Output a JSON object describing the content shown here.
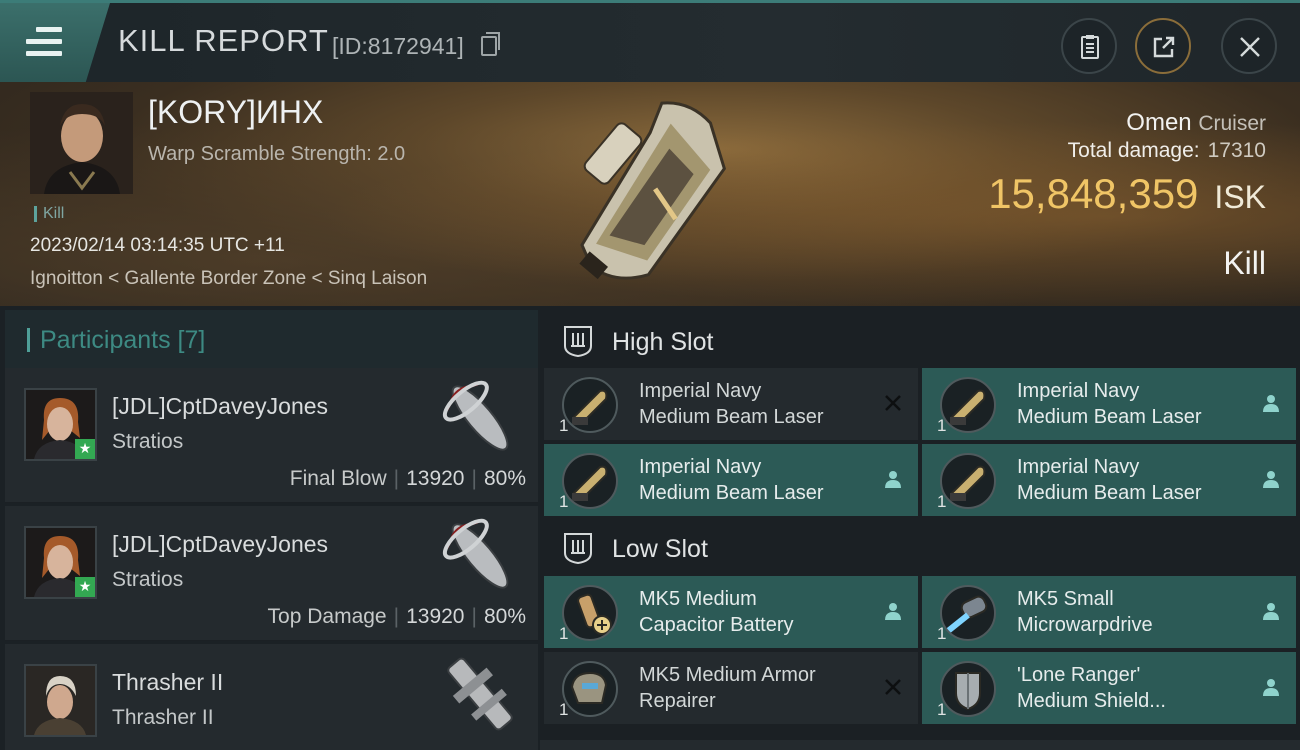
{
  "header": {
    "title": "KILL REPORT",
    "report_id": "[ID:8172941]",
    "icons": {
      "menu": "hamburger-menu-icon",
      "copy": "copy-icon",
      "clipboard": "clipboard-icon",
      "share": "share-icon",
      "close": "close-icon"
    }
  },
  "victim": {
    "name": "[KORY]ИНХ",
    "warp_scramble": "Warp Scramble Strength: 2.0",
    "tag": "Kill",
    "datetime": "2023/02/14 03:14:35 UTC +11",
    "location": "Ignoitton < Gallente Border Zone < Sinq Laison",
    "ship_name": "Omen",
    "ship_class": "Cruiser",
    "total_damage_label": "Total damage:",
    "total_damage": "17310",
    "isk_value": "15,848,359",
    "isk_unit": "ISK",
    "result": "Kill"
  },
  "participants": {
    "title": "Participants [7]",
    "items": [
      {
        "name": "[JDL]CptDaveyJones",
        "ship": "Stratios",
        "label": "Final Blow",
        "damage": "13920",
        "percent": "80%"
      },
      {
        "name": "[JDL]CptDaveyJones",
        "ship": "Stratios",
        "label": "Top Damage",
        "damage": "13920",
        "percent": "80%"
      },
      {
        "name": "Thrasher II",
        "ship": "Thrasher II"
      }
    ]
  },
  "fitting": {
    "high_slot": {
      "title": "High Slot",
      "modules": [
        {
          "qty": "1",
          "line1": "Imperial Navy",
          "line2": "Medium Beam Laser",
          "state": "destroyed"
        },
        {
          "qty": "1",
          "line1": "Imperial Navy",
          "line2": "Medium Beam Laser",
          "state": "dropped"
        },
        {
          "qty": "1",
          "line1": "Imperial Navy",
          "line2": "Medium Beam Laser",
          "state": "dropped"
        },
        {
          "qty": "1",
          "line1": "Imperial Navy",
          "line2": "Medium Beam Laser",
          "state": "dropped"
        }
      ]
    },
    "low_slot": {
      "title": "Low Slot",
      "modules": [
        {
          "qty": "1",
          "line1": "MK5 Medium",
          "line2": "Capacitor Battery",
          "state": "dropped"
        },
        {
          "qty": "1",
          "line1": "MK5 Small",
          "line2": "Microwarpdrive",
          "state": "dropped"
        },
        {
          "qty": "1",
          "line1": "MK5 Medium Armor",
          "line2": "Repairer",
          "state": "destroyed"
        },
        {
          "qty": "1",
          "line1": "'Lone Ranger'",
          "line2": "Medium Shield...",
          "state": "dropped"
        }
      ]
    },
    "colors": {
      "dropped": "#2c5a56",
      "destroyed": "#242a2e",
      "accent": "#4f9f98",
      "isk": "#f0c566"
    }
  }
}
